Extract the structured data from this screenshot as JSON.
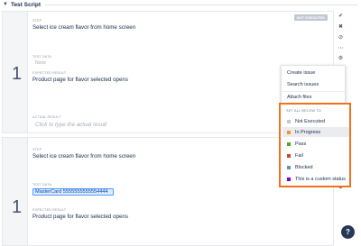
{
  "section": {
    "title": "Test Script",
    "toggle_icon": "chevron-down-icon"
  },
  "steps": [
    {
      "number": "1",
      "status_badge": "NOT EXECUTED",
      "step_label": "STEP",
      "step_value": "Select ice cream flavor from home screen",
      "test_data_label": "TEST DATA",
      "test_data_value": "None",
      "expected_label": "EXPECTED RESULT",
      "expected_value": "Product page for flavor selected opens",
      "actual_label": "ACTUAL RESULT",
      "actual_placeholder": "Click to type the actual result"
    },
    {
      "number": "1",
      "step_label": "STEP",
      "step_value": "Select ice cream flavor from home screen",
      "test_data_label": "TEST DATA",
      "test_data_value": "MasterCard 5555555555554444",
      "expected_label": "EXPECTED RESULT",
      "expected_value": "Product page for flavor selected opens"
    }
  ],
  "rail_icons": [
    "check-icon",
    "close-icon",
    "cancel-circle-icon",
    "more-icon",
    "settings-icon"
  ],
  "menu": {
    "items": [
      "Create issue",
      "Search issues",
      "Attach files"
    ]
  },
  "status_menu": {
    "header": "SET ALL BELOW TO",
    "options": [
      {
        "label": "Not Executed",
        "color": "#c1c7d0"
      },
      {
        "label": "In Progress",
        "color": "#f79232"
      },
      {
        "label": "Pass",
        "color": "#51a825"
      },
      {
        "label": "Fail",
        "color": "#d04437"
      },
      {
        "label": "Blocked",
        "color": "#6693b0"
      },
      {
        "label": "This is a custom status",
        "color": "#8b00c9"
      }
    ],
    "active_index": 1
  },
  "help": {
    "icon": "help-icon",
    "label": "?"
  }
}
